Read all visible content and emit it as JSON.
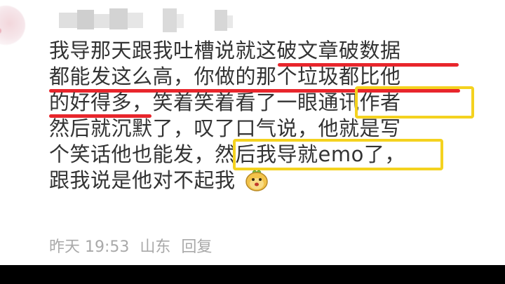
{
  "comment": {
    "lines": [
      "我导那天跟我吐槽说就这破文章破数据",
      "都能发这么高，你做的那个垃圾都比他",
      "的好得多，笑着笑着看了一眼通讯作者",
      "然后就沉默了，叹了口气说，他就是写",
      "个笑话他也能发，然后我导就emo了，",
      "跟我说是他对不起我"
    ],
    "emoji": "face-emoji",
    "time": "昨天 19:53",
    "location": "山东",
    "reply_label": "回复"
  },
  "colors": {
    "text": "#333333",
    "meta": "#a9a9a9",
    "underline": "#e8262c",
    "highlight_box": "#f4d21f"
  }
}
